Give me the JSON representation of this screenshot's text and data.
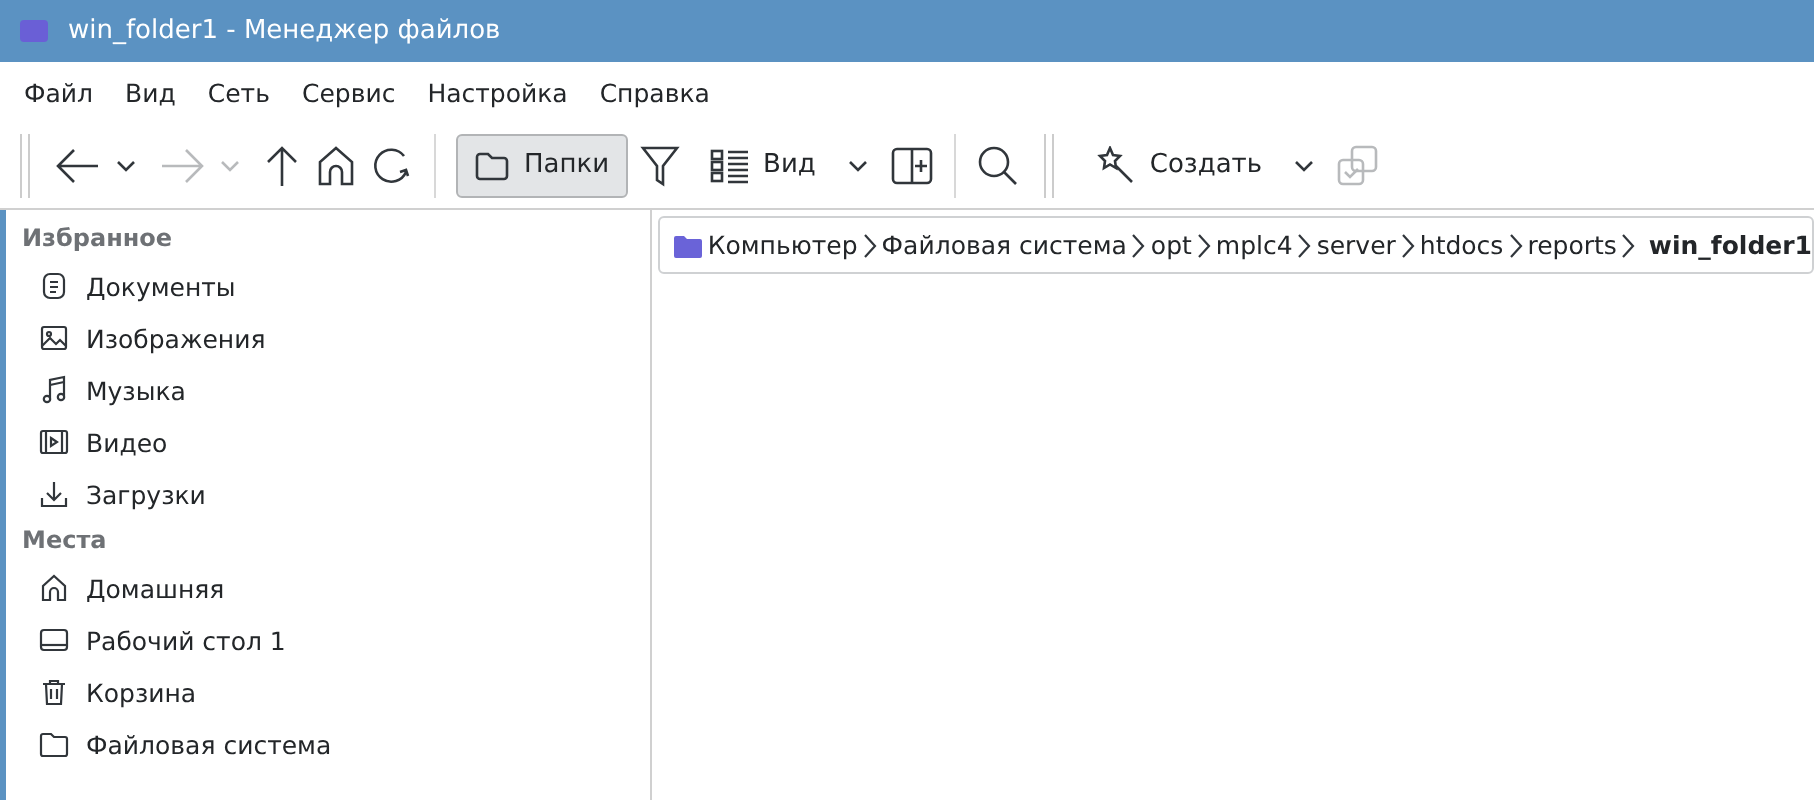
{
  "window": {
    "title": "win_folder1 - Менеджер файлов"
  },
  "menu": [
    "Файл",
    "Вид",
    "Сеть",
    "Сервис",
    "Настройка",
    "Справка"
  ],
  "toolbar": {
    "back": {
      "disabled": false
    },
    "forward": {
      "disabled": true
    },
    "folders_button": {
      "label": "Папки",
      "pressed": true
    },
    "view_button": {
      "label": "Вид"
    },
    "create_button": {
      "label": "Создать"
    }
  },
  "sidebar": [
    {
      "heading": "Избранное",
      "items": [
        "Документы",
        "Изображения",
        "Музыка",
        "Видео",
        "Загрузки"
      ]
    },
    {
      "heading": "Места",
      "items": [
        "Домашняя",
        "Рабочий стол 1",
        "Корзина",
        "Файловая система"
      ]
    }
  ],
  "breadcrumb": [
    {
      "label": "Компьютер",
      "current": false
    },
    {
      "label": "Файловая система",
      "current": false
    },
    {
      "label": "opt",
      "current": false
    },
    {
      "label": "mplc4",
      "current": false
    },
    {
      "label": "server",
      "current": false
    },
    {
      "label": "htdocs",
      "current": false
    },
    {
      "label": "reports",
      "current": false
    },
    {
      "label": "win_folder1",
      "current": true
    }
  ]
}
